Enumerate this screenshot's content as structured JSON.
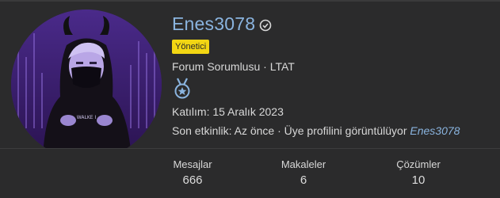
{
  "profile": {
    "username": "Enes3078",
    "badge": "Yönetici",
    "role": "Forum Sorumlusu · LTAT",
    "joined": "Katılım: 15 Aralık 2023",
    "activity_prefix": "Son etkinlik: Az önce · Üye profilini görüntülüyor ",
    "activity_link": "Enes3078",
    "avatar_shirt_text": "WALKE I"
  },
  "stats": [
    {
      "label": "Mesajlar",
      "value": "666"
    },
    {
      "label": "Makaleler",
      "value": "6"
    },
    {
      "label": "Çözümler",
      "value": "10"
    }
  ],
  "colors": {
    "accent": "#8ab4df",
    "badge_bg": "#f2d613",
    "background": "#2b2b2c"
  }
}
